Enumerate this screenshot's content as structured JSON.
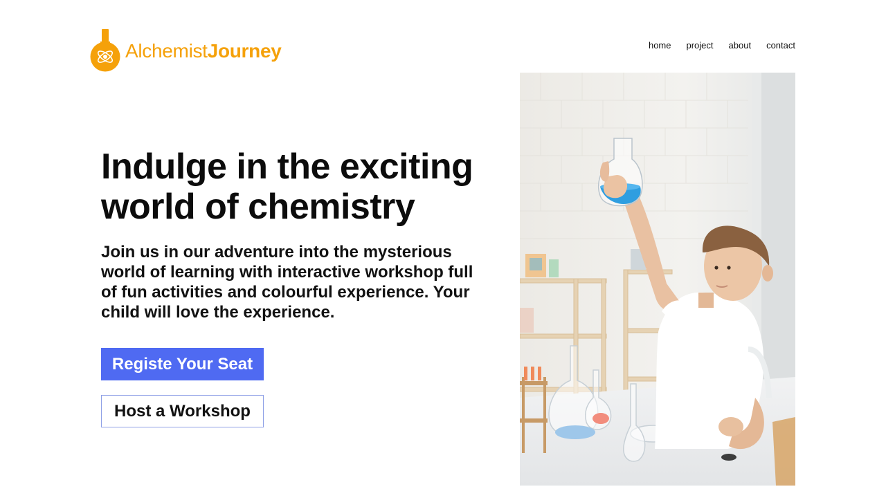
{
  "brand": {
    "name_light": "Alchemist",
    "name_bold": "Journey",
    "icon": "flask-atom-icon",
    "color": "#f5a10a"
  },
  "nav": {
    "items": [
      {
        "label": "home"
      },
      {
        "label": "project"
      },
      {
        "label": "about"
      },
      {
        "label": "contact"
      }
    ]
  },
  "hero": {
    "title": "Indulge in the exciting world of chemistry",
    "description": "Join us in our adventure into the mysterious world of learning with interactive workshop full of fun activities and colourful experience. Your child will love the experience.",
    "primary_button": "Registe Your Seat",
    "secondary_button": "Host a Workshop",
    "accent_color": "#4f6af2"
  }
}
